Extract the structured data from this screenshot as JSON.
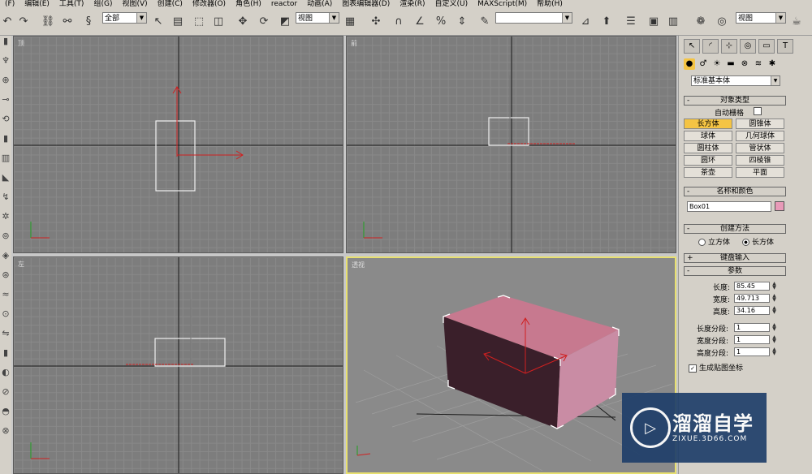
{
  "menu": [
    "(F)",
    "编辑(E)",
    "工具(T)",
    "组(G)",
    "视图(V)",
    "创建(C)",
    "修改器(O)",
    "角色(H)",
    "reactor",
    "动画(A)",
    "图表编辑器(D)",
    "渲染(R)",
    "自定义(U)",
    "MAXScript(M)",
    "帮助(H)"
  ],
  "toolbar": {
    "selection_filter": "全部",
    "ref_coord": "视图",
    "named_selection": "",
    "viewport_select": "视图"
  },
  "viewports": {
    "top": "顶",
    "front": "前",
    "left": "左",
    "perspective": "透视"
  },
  "panel": {
    "category": "标准基本体",
    "object_type_title": "对象类型",
    "auto_grid": "自动栅格",
    "object_buttons": [
      "长方体",
      "圆锥体",
      "球体",
      "几何球体",
      "圆柱体",
      "管状体",
      "圆环",
      "四棱锥",
      "茶壶",
      "平面"
    ],
    "selected_object": "长方体",
    "name_color_title": "名称和颜色",
    "object_name": "Box01",
    "object_color": "#e89ab8",
    "creation_method_title": "创建方法",
    "method_cube": "立方体",
    "method_box": "长方体",
    "keyboard_entry_title": "键盘输入",
    "params_title": "参数",
    "length_label": "长度:",
    "length_value": "85.45",
    "width_label": "宽度:",
    "width_value": "49.713",
    "height_label": "高度:",
    "height_value": "34.16",
    "length_segs_label": "长度分段:",
    "length_segs_value": "1",
    "width_segs_label": "宽度分段:",
    "width_segs_value": "1",
    "height_segs_label": "高度分段:",
    "height_segs_value": "1",
    "gen_map_coords": "生成贴图坐标"
  },
  "watermark": {
    "title": "溜溜自学",
    "url": "ZIXUE.3D66.COM"
  },
  "colors": {
    "box_top": "#c7798f",
    "box_front": "#3a1f2a",
    "box_side": "#c98ca4",
    "active_border": "#e8e070",
    "highlight": "#f4c444"
  }
}
